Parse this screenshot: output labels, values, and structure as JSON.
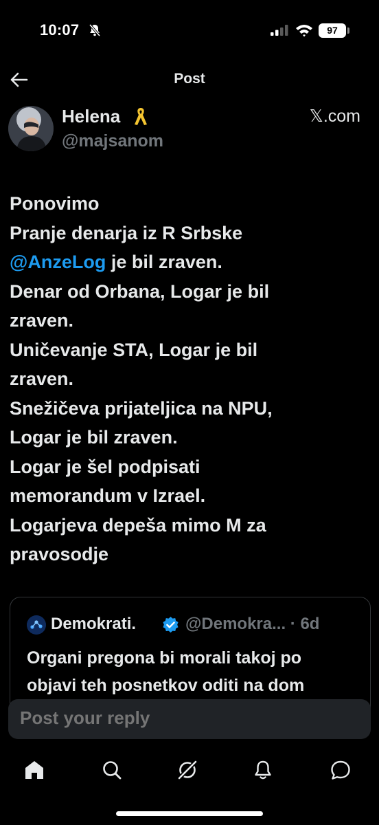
{
  "status_bar": {
    "time": "10:07",
    "battery": "97"
  },
  "header": {
    "title": "Post"
  },
  "author": {
    "name": "Helena",
    "handle": "@majsanom",
    "source": "𝕏.com"
  },
  "post": {
    "lines": [
      {
        "text": "Ponovimo"
      },
      {
        "text": "Pranje denarja iz R Srbske"
      },
      {
        "mention": "@AnzeLog",
        "text": " je bil zraven."
      },
      {
        "text": "Denar od Orbana, Logar je bil"
      },
      {
        "text": "zraven."
      },
      {
        "text": "Uničevanje STA, Logar je bil"
      },
      {
        "text": "zraven."
      },
      {
        "text": "Snežičeva prijateljica na NPU,"
      },
      {
        "text": "Logar je bil zraven."
      },
      {
        "text": "Logar je šel podpisati"
      },
      {
        "text": "memorandum v Izrael."
      },
      {
        "text": "Logarjeva depeša mimo M za"
      },
      {
        "text": "pravosodje"
      }
    ]
  },
  "quote": {
    "name": "Demokrati.",
    "handle_time": "@Demokra... · 6d",
    "text_line1": "Organi pregona bi morali takoj po",
    "text_line2": "objavi teh posnetkov oditi na dom"
  },
  "reply": {
    "placeholder": "Post your reply"
  },
  "nav": {
    "items": [
      "home-icon",
      "search-icon",
      "grok-icon",
      "notifications-icon",
      "messages-icon"
    ]
  },
  "colors": {
    "background": "#000000",
    "text": "#e7e9ea",
    "secondary": "#71767b",
    "accent": "#1d9bf0"
  }
}
